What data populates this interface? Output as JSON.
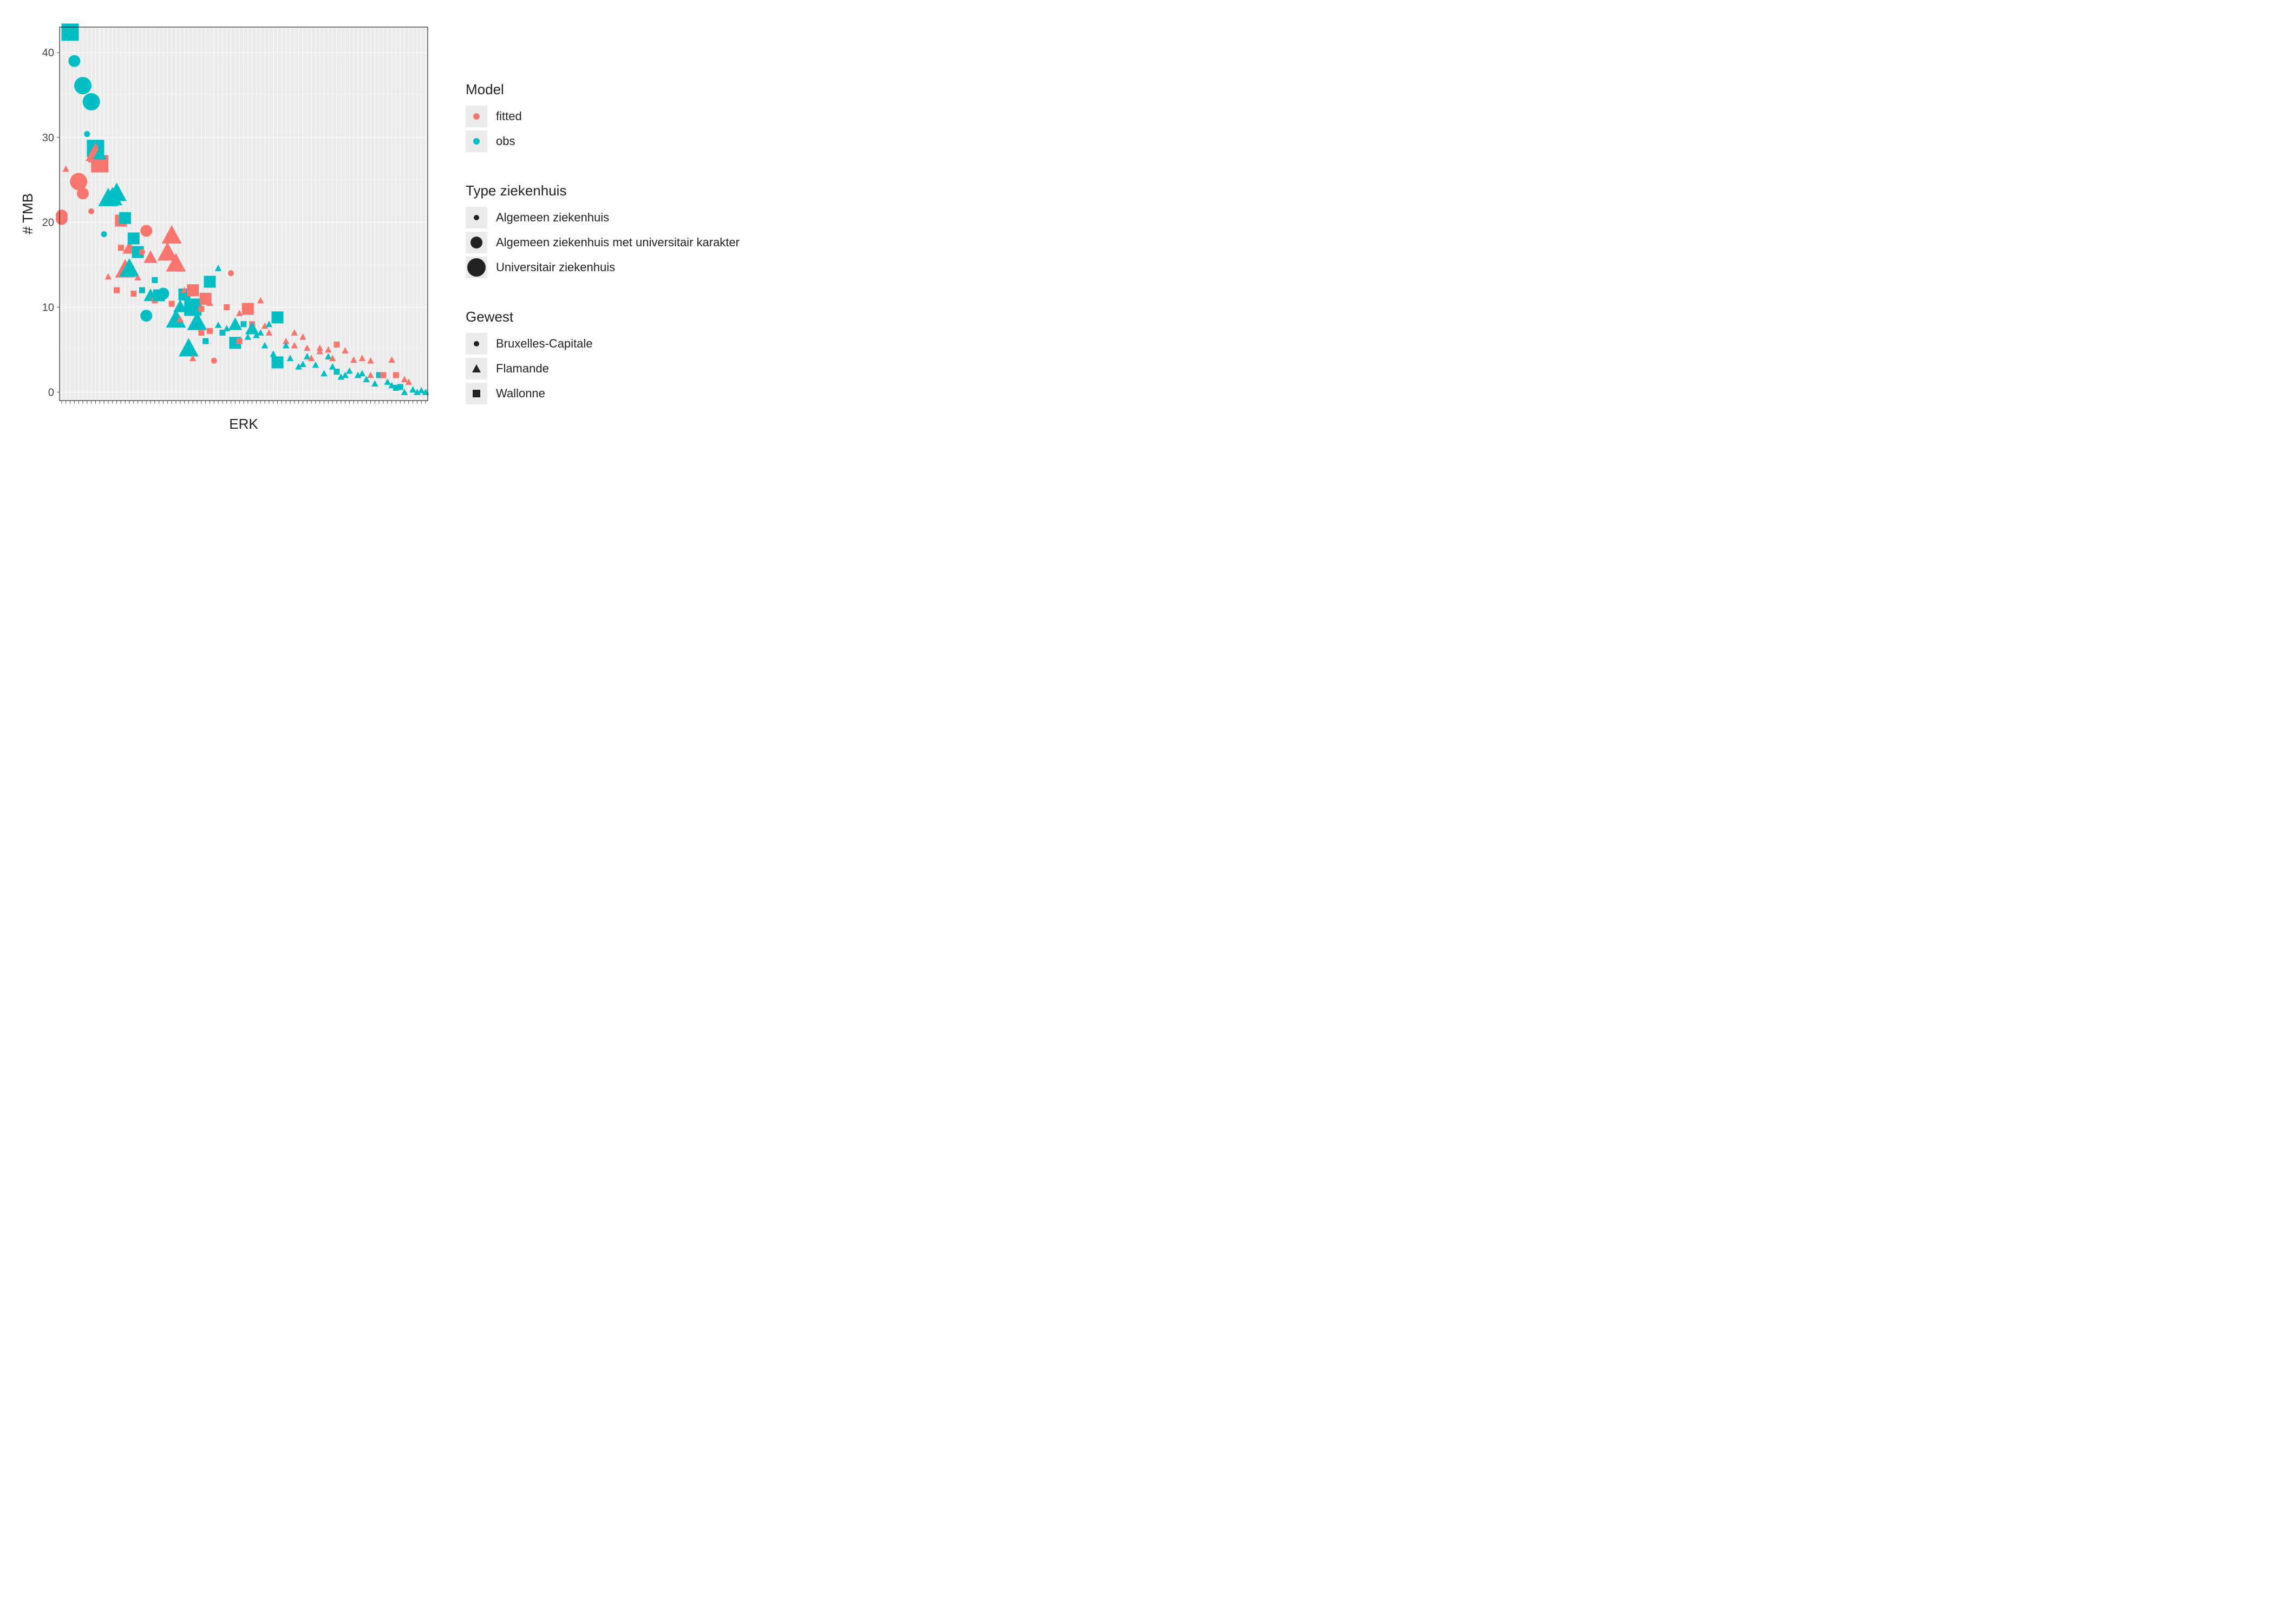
{
  "chart_data": {
    "type": "scatter",
    "xlabel": "ERK",
    "ylabel": "# TMB",
    "ylim": [
      -1,
      43
    ],
    "yticks": [
      0,
      10,
      20,
      30,
      40
    ],
    "x_categorical_count": 87,
    "colors": {
      "fitted": "#f8766d",
      "obs": "#00bfc4"
    },
    "shapes": {
      "Bruxelles-Capitale": "circle",
      "Flamande": "triangle",
      "Wallonne": "square"
    },
    "sizes": {
      "Algemeen ziekenhuis": 1,
      "Algemeen ziekenhuis met universitair karakter": 2,
      "Universitair ziekenhuis": 3
    },
    "legends": {
      "color": {
        "title": "Model",
        "items": [
          "fitted",
          "obs"
        ]
      },
      "size": {
        "title": "Type ziekenhuis",
        "items": [
          "Algemeen ziekenhuis",
          "Algemeen ziekenhuis met universitair karakter",
          "Universitair ziekenhuis"
        ]
      },
      "shape": {
        "title": "Gewest",
        "items": [
          "Bruxelles-Capitale",
          "Flamande",
          "Wallonne"
        ]
      }
    },
    "points": [
      {
        "x": 1,
        "y": 20.8,
        "model": "fitted",
        "shape": "circle",
        "size": 2
      },
      {
        "x": 1,
        "y": 20.4,
        "model": "fitted",
        "shape": "circle",
        "size": 2
      },
      {
        "x": 2,
        "y": 26.3,
        "model": "fitted",
        "shape": "triangle",
        "size": 1
      },
      {
        "x": 3,
        "y": 42.4,
        "model": "obs",
        "shape": "square",
        "size": 3
      },
      {
        "x": 4,
        "y": 39.0,
        "model": "obs",
        "shape": "circle",
        "size": 2
      },
      {
        "x": 5,
        "y": 24.8,
        "model": "fitted",
        "shape": "circle",
        "size": 3
      },
      {
        "x": 6,
        "y": 36.1,
        "model": "obs",
        "shape": "circle",
        "size": 3
      },
      {
        "x": 6,
        "y": 23.4,
        "model": "fitted",
        "shape": "circle",
        "size": 2
      },
      {
        "x": 7,
        "y": 30.4,
        "model": "obs",
        "shape": "circle",
        "size": 1
      },
      {
        "x": 8,
        "y": 34.2,
        "model": "obs",
        "shape": "circle",
        "size": 3
      },
      {
        "x": 8,
        "y": 27.4,
        "model": "fitted",
        "shape": "square",
        "size": 1
      },
      {
        "x": 8,
        "y": 21.3,
        "model": "fitted",
        "shape": "circle",
        "size": 1
      },
      {
        "x": 9,
        "y": 28.7,
        "model": "obs",
        "shape": "square",
        "size": 3
      },
      {
        "x": 9,
        "y": 28.2,
        "model": "fitted",
        "shape": "triangle",
        "size": 3
      },
      {
        "x": 10,
        "y": 26.9,
        "model": "fitted",
        "shape": "square",
        "size": 3
      },
      {
        "x": 10,
        "y": 28.1,
        "model": "obs",
        "shape": "triangle",
        "size": 2
      },
      {
        "x": 11,
        "y": 18.6,
        "model": "obs",
        "shape": "circle",
        "size": 1
      },
      {
        "x": 12,
        "y": 22.9,
        "model": "obs",
        "shape": "triangle",
        "size": 3
      },
      {
        "x": 12,
        "y": 13.6,
        "model": "fitted",
        "shape": "triangle",
        "size": 1
      },
      {
        "x": 13,
        "y": 23.0,
        "model": "obs",
        "shape": "triangle",
        "size": 3
      },
      {
        "x": 14,
        "y": 23.5,
        "model": "obs",
        "shape": "triangle",
        "size": 3
      },
      {
        "x": 14,
        "y": 12.0,
        "model": "fitted",
        "shape": "square",
        "size": 1
      },
      {
        "x": 15,
        "y": 17.0,
        "model": "fitted",
        "shape": "square",
        "size": 1
      },
      {
        "x": 15,
        "y": 20.2,
        "model": "fitted",
        "shape": "square",
        "size": 2
      },
      {
        "x": 16,
        "y": 20.5,
        "model": "obs",
        "shape": "square",
        "size": 2
      },
      {
        "x": 16,
        "y": 14.5,
        "model": "fitted",
        "shape": "triangle",
        "size": 3
      },
      {
        "x": 17,
        "y": 17.0,
        "model": "fitted",
        "shape": "triangle",
        "size": 2
      },
      {
        "x": 17,
        "y": 14.6,
        "model": "obs",
        "shape": "triangle",
        "size": 3
      },
      {
        "x": 18,
        "y": 18.1,
        "model": "obs",
        "shape": "square",
        "size": 2
      },
      {
        "x": 18,
        "y": 11.6,
        "model": "fitted",
        "shape": "square",
        "size": 1
      },
      {
        "x": 19,
        "y": 16.5,
        "model": "obs",
        "shape": "square",
        "size": 2
      },
      {
        "x": 19,
        "y": 13.5,
        "model": "fitted",
        "shape": "triangle",
        "size": 1
      },
      {
        "x": 20,
        "y": 12.0,
        "model": "obs",
        "shape": "square",
        "size": 1
      },
      {
        "x": 20,
        "y": 16.5,
        "model": "fitted",
        "shape": "circle",
        "size": 1
      },
      {
        "x": 21,
        "y": 19.0,
        "model": "fitted",
        "shape": "circle",
        "size": 2
      },
      {
        "x": 21,
        "y": 9.0,
        "model": "obs",
        "shape": "circle",
        "size": 2
      },
      {
        "x": 22,
        "y": 11.4,
        "model": "obs",
        "shape": "triangle",
        "size": 2
      },
      {
        "x": 22,
        "y": 15.9,
        "model": "fitted",
        "shape": "triangle",
        "size": 2
      },
      {
        "x": 23,
        "y": 10.8,
        "model": "fitted",
        "shape": "square",
        "size": 1
      },
      {
        "x": 23,
        "y": 13.2,
        "model": "obs",
        "shape": "square",
        "size": 1
      },
      {
        "x": 24,
        "y": 11.4,
        "model": "obs",
        "shape": "square",
        "size": 2
      },
      {
        "x": 25,
        "y": 11.3,
        "model": "fitted",
        "shape": "square",
        "size": 1
      },
      {
        "x": 25,
        "y": 11.6,
        "model": "obs",
        "shape": "circle",
        "size": 2
      },
      {
        "x": 26,
        "y": 16.5,
        "model": "fitted",
        "shape": "triangle",
        "size": 3
      },
      {
        "x": 27,
        "y": 10.4,
        "model": "fitted",
        "shape": "square",
        "size": 1
      },
      {
        "x": 27,
        "y": 18.5,
        "model": "fitted",
        "shape": "triangle",
        "size": 3
      },
      {
        "x": 28,
        "y": 15.2,
        "model": "fitted",
        "shape": "triangle",
        "size": 3
      },
      {
        "x": 28,
        "y": 8.6,
        "model": "obs",
        "shape": "triangle",
        "size": 3
      },
      {
        "x": 29,
        "y": 10.1,
        "model": "obs",
        "shape": "triangle",
        "size": 2
      },
      {
        "x": 29,
        "y": 8.6,
        "model": "fitted",
        "shape": "triangle",
        "size": 1
      },
      {
        "x": 30,
        "y": 11.5,
        "model": "obs",
        "shape": "square",
        "size": 2
      },
      {
        "x": 30,
        "y": 12.0,
        "model": "fitted",
        "shape": "triangle",
        "size": 1
      },
      {
        "x": 31,
        "y": 11.7,
        "model": "obs",
        "shape": "square",
        "size": 1
      },
      {
        "x": 31,
        "y": 5.2,
        "model": "obs",
        "shape": "triangle",
        "size": 3
      },
      {
        "x": 32,
        "y": 10.0,
        "model": "obs",
        "shape": "square",
        "size": 3
      },
      {
        "x": 32,
        "y": 12.0,
        "model": "fitted",
        "shape": "square",
        "size": 2
      },
      {
        "x": 32,
        "y": 4.0,
        "model": "fitted",
        "shape": "triangle",
        "size": 1
      },
      {
        "x": 33,
        "y": 8.3,
        "model": "obs",
        "shape": "triangle",
        "size": 3
      },
      {
        "x": 34,
        "y": 7.0,
        "model": "fitted",
        "shape": "square",
        "size": 1
      },
      {
        "x": 34,
        "y": 9.8,
        "model": "fitted",
        "shape": "square",
        "size": 1
      },
      {
        "x": 35,
        "y": 11.0,
        "model": "fitted",
        "shape": "square",
        "size": 2
      },
      {
        "x": 35,
        "y": 6.0,
        "model": "obs",
        "shape": "square",
        "size": 1
      },
      {
        "x": 36,
        "y": 13.0,
        "model": "obs",
        "shape": "square",
        "size": 2
      },
      {
        "x": 36,
        "y": 7.2,
        "model": "fitted",
        "shape": "square",
        "size": 1
      },
      {
        "x": 36,
        "y": 10.5,
        "model": "fitted",
        "shape": "triangle",
        "size": 1
      },
      {
        "x": 37,
        "y": 3.7,
        "model": "fitted",
        "shape": "circle",
        "size": 1
      },
      {
        "x": 38,
        "y": 7.9,
        "model": "obs",
        "shape": "triangle",
        "size": 1
      },
      {
        "x": 38,
        "y": 14.6,
        "model": "obs",
        "shape": "triangle",
        "size": 1
      },
      {
        "x": 39,
        "y": 7.0,
        "model": "obs",
        "shape": "square",
        "size": 1
      },
      {
        "x": 40,
        "y": 10.0,
        "model": "fitted",
        "shape": "square",
        "size": 1
      },
      {
        "x": 40,
        "y": 7.5,
        "model": "obs",
        "shape": "triangle",
        "size": 1
      },
      {
        "x": 41,
        "y": 14.0,
        "model": "fitted",
        "shape": "circle",
        "size": 1
      },
      {
        "x": 42,
        "y": 8.0,
        "model": "obs",
        "shape": "triangle",
        "size": 2
      },
      {
        "x": 42,
        "y": 5.8,
        "model": "obs",
        "shape": "square",
        "size": 2
      },
      {
        "x": 43,
        "y": 6.0,
        "model": "fitted",
        "shape": "square",
        "size": 1
      },
      {
        "x": 43,
        "y": 9.3,
        "model": "fitted",
        "shape": "triangle",
        "size": 1
      },
      {
        "x": 44,
        "y": 8.0,
        "model": "obs",
        "shape": "square",
        "size": 1
      },
      {
        "x": 45,
        "y": 9.8,
        "model": "fitted",
        "shape": "square",
        "size": 2
      },
      {
        "x": 45,
        "y": 6.5,
        "model": "obs",
        "shape": "triangle",
        "size": 1
      },
      {
        "x": 46,
        "y": 8.0,
        "model": "fitted",
        "shape": "square",
        "size": 1
      },
      {
        "x": 46,
        "y": 7.5,
        "model": "obs",
        "shape": "triangle",
        "size": 2
      },
      {
        "x": 47,
        "y": 6.7,
        "model": "obs",
        "shape": "triangle",
        "size": 1
      },
      {
        "x": 48,
        "y": 7.0,
        "model": "obs",
        "shape": "triangle",
        "size": 1
      },
      {
        "x": 48,
        "y": 10.8,
        "model": "fitted",
        "shape": "triangle",
        "size": 1
      },
      {
        "x": 49,
        "y": 7.8,
        "model": "fitted",
        "shape": "triangle",
        "size": 1
      },
      {
        "x": 49,
        "y": 5.5,
        "model": "obs",
        "shape": "triangle",
        "size": 1
      },
      {
        "x": 50,
        "y": 7.0,
        "model": "fitted",
        "shape": "triangle",
        "size": 1
      },
      {
        "x": 50,
        "y": 8.0,
        "model": "obs",
        "shape": "triangle",
        "size": 1
      },
      {
        "x": 51,
        "y": 4.5,
        "model": "obs",
        "shape": "triangle",
        "size": 1
      },
      {
        "x": 52,
        "y": 9.0,
        "model": "fitted",
        "shape": "square",
        "size": 1
      },
      {
        "x": 52,
        "y": 3.5,
        "model": "obs",
        "shape": "square",
        "size": 2
      },
      {
        "x": 52,
        "y": 8.8,
        "model": "obs",
        "shape": "square",
        "size": 2
      },
      {
        "x": 54,
        "y": 6.0,
        "model": "fitted",
        "shape": "triangle",
        "size": 1
      },
      {
        "x": 54,
        "y": 5.5,
        "model": "obs",
        "shape": "triangle",
        "size": 1
      },
      {
        "x": 55,
        "y": 4.0,
        "model": "obs",
        "shape": "triangle",
        "size": 1
      },
      {
        "x": 56,
        "y": 5.5,
        "model": "fitted",
        "shape": "triangle",
        "size": 1
      },
      {
        "x": 56,
        "y": 7.0,
        "model": "fitted",
        "shape": "triangle",
        "size": 1
      },
      {
        "x": 57,
        "y": 3.0,
        "model": "obs",
        "shape": "triangle",
        "size": 1
      },
      {
        "x": 58,
        "y": 3.3,
        "model": "obs",
        "shape": "triangle",
        "size": 1
      },
      {
        "x": 58,
        "y": 6.5,
        "model": "fitted",
        "shape": "triangle",
        "size": 1
      },
      {
        "x": 59,
        "y": 4.2,
        "model": "obs",
        "shape": "triangle",
        "size": 1
      },
      {
        "x": 59,
        "y": 5.2,
        "model": "fitted",
        "shape": "triangle",
        "size": 1
      },
      {
        "x": 60,
        "y": 4.0,
        "model": "fitted",
        "shape": "triangle",
        "size": 1
      },
      {
        "x": 61,
        "y": 3.2,
        "model": "obs",
        "shape": "triangle",
        "size": 1
      },
      {
        "x": 62,
        "y": 4.8,
        "model": "fitted",
        "shape": "triangle",
        "size": 1
      },
      {
        "x": 62,
        "y": 5.2,
        "model": "fitted",
        "shape": "triangle",
        "size": 1
      },
      {
        "x": 63,
        "y": 2.2,
        "model": "obs",
        "shape": "triangle",
        "size": 1
      },
      {
        "x": 64,
        "y": 4.2,
        "model": "obs",
        "shape": "triangle",
        "size": 1
      },
      {
        "x": 64,
        "y": 5.0,
        "model": "fitted",
        "shape": "triangle",
        "size": 1
      },
      {
        "x": 65,
        "y": 3.0,
        "model": "obs",
        "shape": "triangle",
        "size": 1
      },
      {
        "x": 65,
        "y": 4.0,
        "model": "fitted",
        "shape": "triangle",
        "size": 1
      },
      {
        "x": 66,
        "y": 2.4,
        "model": "obs",
        "shape": "square",
        "size": 1
      },
      {
        "x": 66,
        "y": 5.6,
        "model": "fitted",
        "shape": "square",
        "size": 1
      },
      {
        "x": 67,
        "y": 1.8,
        "model": "obs",
        "shape": "triangle",
        "size": 1
      },
      {
        "x": 68,
        "y": 2.0,
        "model": "obs",
        "shape": "triangle",
        "size": 1
      },
      {
        "x": 68,
        "y": 4.9,
        "model": "fitted",
        "shape": "triangle",
        "size": 1
      },
      {
        "x": 69,
        "y": 2.5,
        "model": "obs",
        "shape": "triangle",
        "size": 1
      },
      {
        "x": 70,
        "y": 3.8,
        "model": "fitted",
        "shape": "triangle",
        "size": 1
      },
      {
        "x": 71,
        "y": 2.0,
        "model": "obs",
        "shape": "triangle",
        "size": 1
      },
      {
        "x": 72,
        "y": 4.0,
        "model": "fitted",
        "shape": "triangle",
        "size": 1
      },
      {
        "x": 72,
        "y": 2.2,
        "model": "obs",
        "shape": "triangle",
        "size": 1
      },
      {
        "x": 73,
        "y": 1.5,
        "model": "obs",
        "shape": "triangle",
        "size": 1
      },
      {
        "x": 74,
        "y": 2.0,
        "model": "fitted",
        "shape": "triangle",
        "size": 1
      },
      {
        "x": 74,
        "y": 3.7,
        "model": "fitted",
        "shape": "triangle",
        "size": 1
      },
      {
        "x": 75,
        "y": 1.0,
        "model": "obs",
        "shape": "triangle",
        "size": 1
      },
      {
        "x": 76,
        "y": 2.0,
        "model": "obs",
        "shape": "square",
        "size": 1
      },
      {
        "x": 77,
        "y": 2.0,
        "model": "fitted",
        "shape": "square",
        "size": 1
      },
      {
        "x": 78,
        "y": 1.2,
        "model": "obs",
        "shape": "triangle",
        "size": 1
      },
      {
        "x": 79,
        "y": 3.8,
        "model": "fitted",
        "shape": "triangle",
        "size": 1
      },
      {
        "x": 79,
        "y": 0.8,
        "model": "obs",
        "shape": "triangle",
        "size": 1
      },
      {
        "x": 80,
        "y": 2.0,
        "model": "fitted",
        "shape": "square",
        "size": 1
      },
      {
        "x": 80,
        "y": 0.5,
        "model": "obs",
        "shape": "square",
        "size": 1
      },
      {
        "x": 81,
        "y": 0.6,
        "model": "obs",
        "shape": "square",
        "size": 1
      },
      {
        "x": 82,
        "y": 0.0,
        "model": "obs",
        "shape": "triangle",
        "size": 1
      },
      {
        "x": 82,
        "y": 1.5,
        "model": "fitted",
        "shape": "triangle",
        "size": 1
      },
      {
        "x": 83,
        "y": 1.2,
        "model": "fitted",
        "shape": "triangle",
        "size": 1
      },
      {
        "x": 84,
        "y": 0.3,
        "model": "obs",
        "shape": "triangle",
        "size": 1
      },
      {
        "x": 85,
        "y": 0.0,
        "model": "obs",
        "shape": "triangle",
        "size": 1
      },
      {
        "x": 86,
        "y": 0.2,
        "model": "obs",
        "shape": "triangle",
        "size": 1
      },
      {
        "x": 87,
        "y": 0.0,
        "model": "obs",
        "shape": "triangle",
        "size": 1
      }
    ]
  }
}
